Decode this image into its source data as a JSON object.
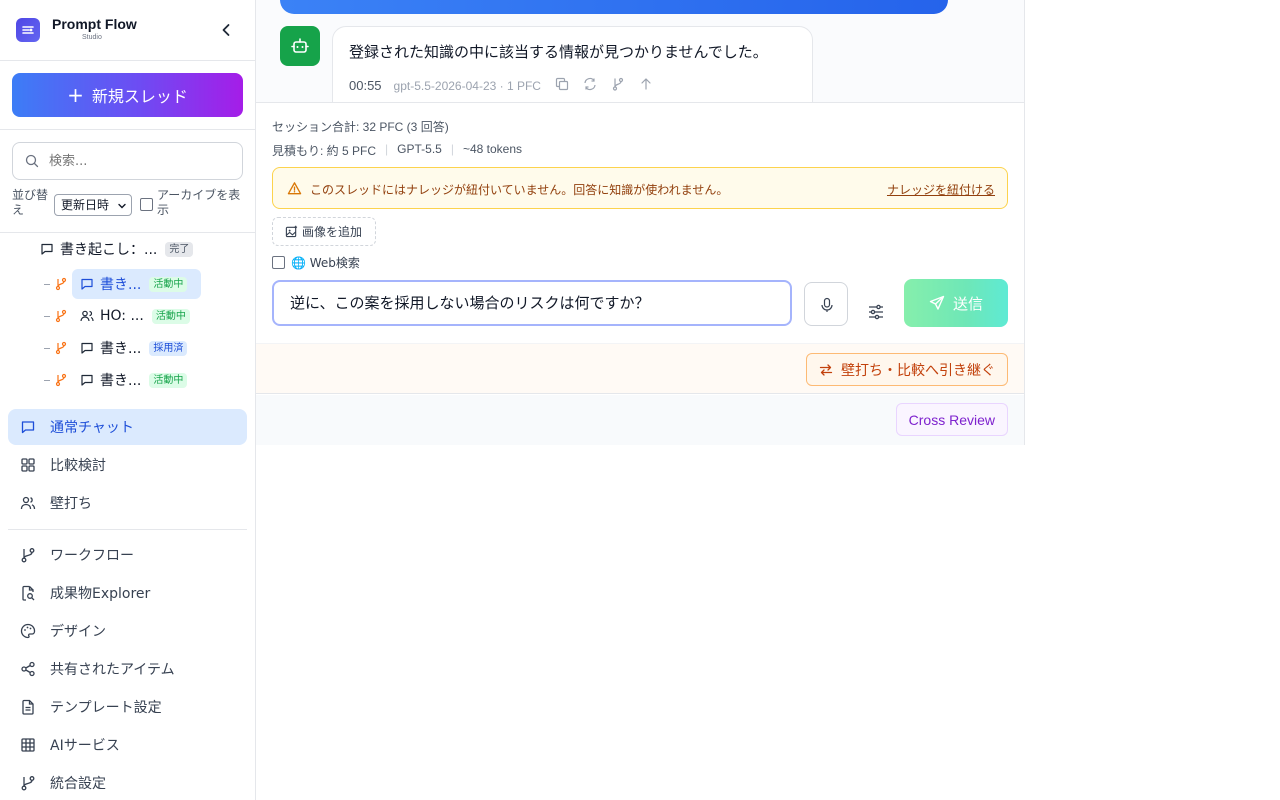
{
  "brand": {
    "name": "Prompt Flow",
    "sub": "Studio"
  },
  "sidebar": {
    "new_thread_label": "新規スレッド",
    "search_placeholder": "検索...",
    "sort_label": "並び替え",
    "sort_value": "更新日時",
    "archive_label": "アーカイブを表示",
    "tree": {
      "root": {
        "label": "書き起こし：...",
        "badge": "完了"
      },
      "children": [
        {
          "label": "書き...",
          "badge": "活動中",
          "icon": "chat-icon",
          "branch": "branch-icon"
        },
        {
          "label": "HO: ...",
          "badge": "活動中",
          "icon": "users-icon",
          "branch": "link-icon"
        },
        {
          "label": "書き...",
          "badge": "採用済",
          "icon": "chat-icon",
          "branch": "branch-icon"
        },
        {
          "label": "書き...",
          "badge": "活動中",
          "icon": "chat-icon",
          "branch": "branch-icon"
        }
      ]
    },
    "modes": [
      {
        "label": "通常チャット",
        "icon": "chat-icon",
        "active": true
      },
      {
        "label": "比較検討",
        "icon": "grid-icon"
      },
      {
        "label": "壁打ち",
        "icon": "users-icon"
      }
    ],
    "tools": [
      {
        "label": "ワークフロー",
        "icon": "workflow-icon"
      },
      {
        "label": "成果物Explorer",
        "icon": "file-search-icon"
      },
      {
        "label": "デザイン",
        "icon": "palette-icon"
      },
      {
        "label": "共有されたアイテム",
        "icon": "share-icon"
      },
      {
        "label": "テンプレート設定",
        "icon": "document-icon"
      },
      {
        "label": "AIサービス",
        "icon": "table-icon"
      },
      {
        "label": "統合設定",
        "icon": "workflow-icon"
      }
    ]
  },
  "chat": {
    "bot_message": "登録された知識の中に該当する情報が見つかりませんでした。",
    "bot_time": "00:55",
    "bot_model": "gpt-5.5-2026-04-23 · 1 PFC"
  },
  "composer": {
    "session_total": "セッション合計: 32 PFC (3 回答)",
    "estimate": "見積もり: 約 5 PFC",
    "model": "GPT-5.5",
    "tokens": "~48 tokens",
    "warning": "このスレッドにはナレッジが紐付いていません。回答に知識が使われません。",
    "warning_link": "ナレッジを紐付ける",
    "add_image": "画像を追加",
    "web_search": "🌐 Web検索",
    "input_value": "逆に、この案を採用しない場合のリスクは何ですか？",
    "send_label": "送信"
  },
  "handoff": {
    "label": "壁打ち・比較へ引き継ぐ"
  },
  "review": {
    "label": "Cross Review"
  },
  "colors": {
    "accent": "#1d4ed8",
    "active_bg": "#dbeafe",
    "bot_avatar": "#16a34a",
    "warning_bg": "#fffbeb",
    "handoff": "#c2410c",
    "review": "#7e22ce"
  }
}
